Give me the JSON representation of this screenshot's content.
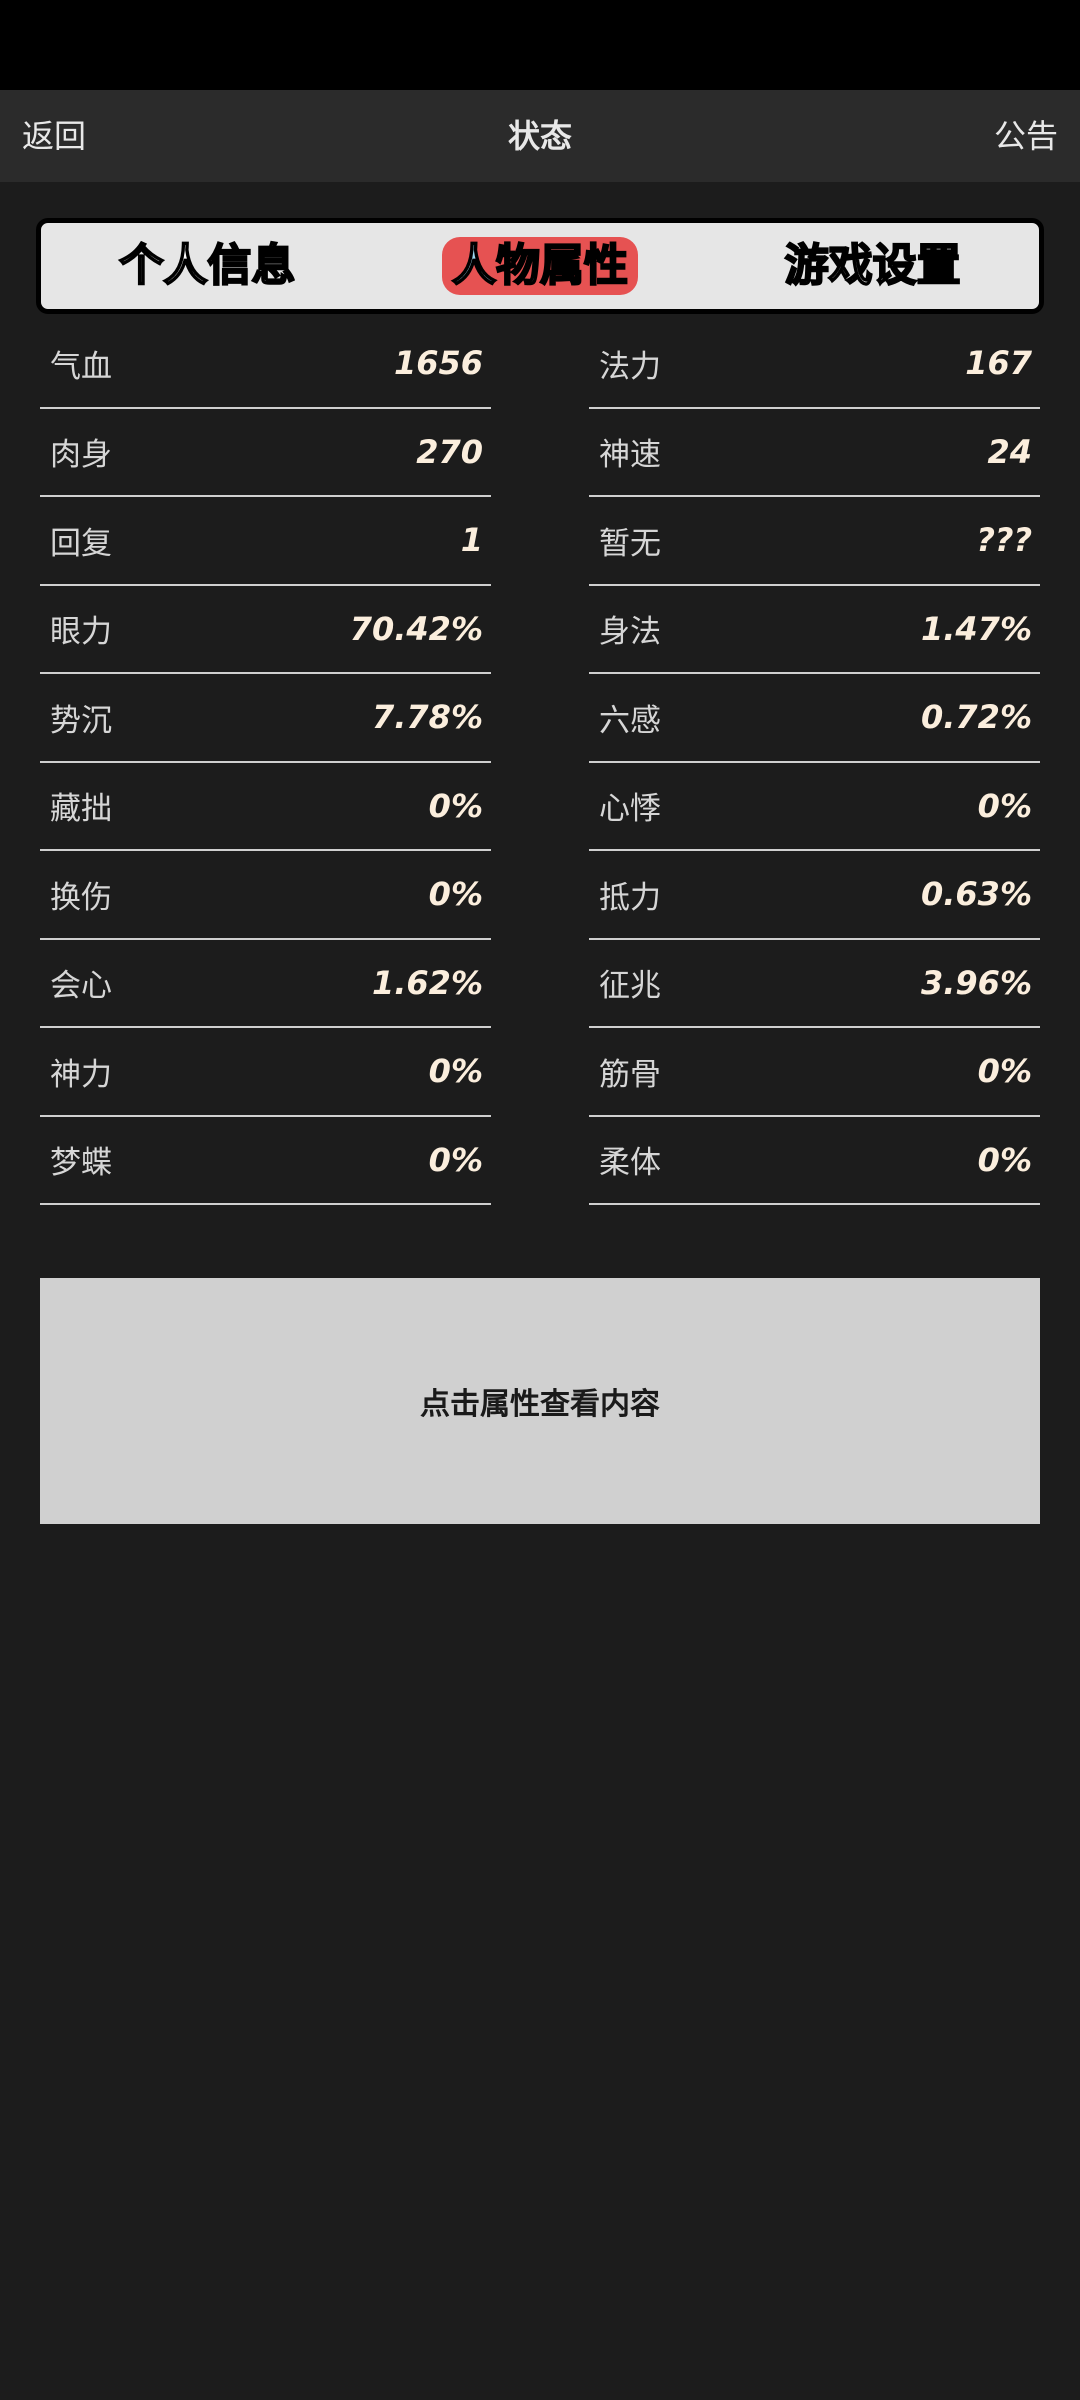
{
  "header": {
    "back_label": "返回",
    "title": "状态",
    "notice_label": "公告"
  },
  "tabs": [
    {
      "label": "个人信息",
      "active": false
    },
    {
      "label": "人物属性",
      "active": true
    },
    {
      "label": "游戏设置",
      "active": false
    }
  ],
  "stats": [
    [
      {
        "name": "气血",
        "value": "1656"
      },
      {
        "name": "法力",
        "value": "167"
      }
    ],
    [
      {
        "name": "肉身",
        "value": "270"
      },
      {
        "name": "神速",
        "value": "24"
      }
    ],
    [
      {
        "name": "回复",
        "value": "1"
      },
      {
        "name": "暂无",
        "value": "???"
      }
    ],
    [
      {
        "name": "眼力",
        "value": "70.42%"
      },
      {
        "name": "身法",
        "value": "1.47%"
      }
    ],
    [
      {
        "name": "势沉",
        "value": "7.78%"
      },
      {
        "name": "六感",
        "value": "0.72%"
      }
    ],
    [
      {
        "name": "藏拙",
        "value": "0%"
      },
      {
        "name": "心悸",
        "value": "0%"
      }
    ],
    [
      {
        "name": "换伤",
        "value": "0%"
      },
      {
        "name": "抵力",
        "value": "0.63%"
      }
    ],
    [
      {
        "name": "会心",
        "value": "1.62%"
      },
      {
        "name": "征兆",
        "value": "3.96%"
      }
    ],
    [
      {
        "name": "神力",
        "value": "0%"
      },
      {
        "name": "筋骨",
        "value": "0%"
      }
    ],
    [
      {
        "name": "梦蝶",
        "value": "0%"
      },
      {
        "name": "柔体",
        "value": "0%"
      }
    ]
  ],
  "info_panel": {
    "message": "点击属性查看内容"
  },
  "colors": {
    "background": "#1c1c1c",
    "active_tab": "#e65252",
    "value_text": "#fbeedd"
  }
}
